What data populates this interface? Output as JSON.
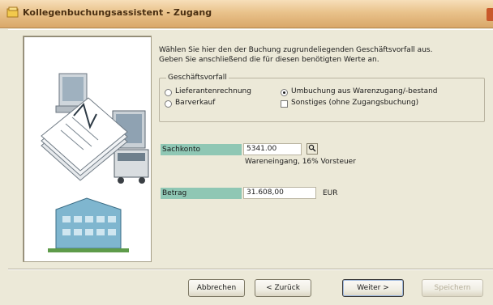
{
  "window": {
    "title": "Kollegenbuchungsassistent - Zugang"
  },
  "intro": {
    "line1": "Wählen Sie hier den der Buchung zugrundeliegenden Geschäftsvorfall aus.",
    "line2": "Geben Sie anschließend die für diesen benötigten Werte an."
  },
  "transaction_group": {
    "legend": "Geschäftsvorfall",
    "options": [
      {
        "label": "Lieferantenrechnung",
        "control": "radio",
        "checked": false
      },
      {
        "label": "Umbuchung aus Warenzugang/-bestand",
        "control": "radio",
        "checked": true
      },
      {
        "label": "Barverkauf",
        "control": "radio",
        "checked": false
      },
      {
        "label": "Sonstiges (ohne Zugangsbuchung)",
        "control": "checkbox",
        "checked": false
      }
    ]
  },
  "fields": {
    "account": {
      "label": "Sachkonto",
      "value": "5341.00",
      "lookup_icon": "search-icon",
      "description": "Wareneingang, 16% Vorsteuer"
    },
    "amount": {
      "label": "Betrag",
      "value": "31.608,00",
      "currency": "EUR"
    }
  },
  "buttons": {
    "cancel": "Abbrechen",
    "back": "< Zurück",
    "next": "Weiter >",
    "finish": "Speichern"
  },
  "colors": {
    "titlebar": "#e0b47a",
    "field_label_bg": "#8fc7b4",
    "dialog_bg": "#ece9d8"
  }
}
